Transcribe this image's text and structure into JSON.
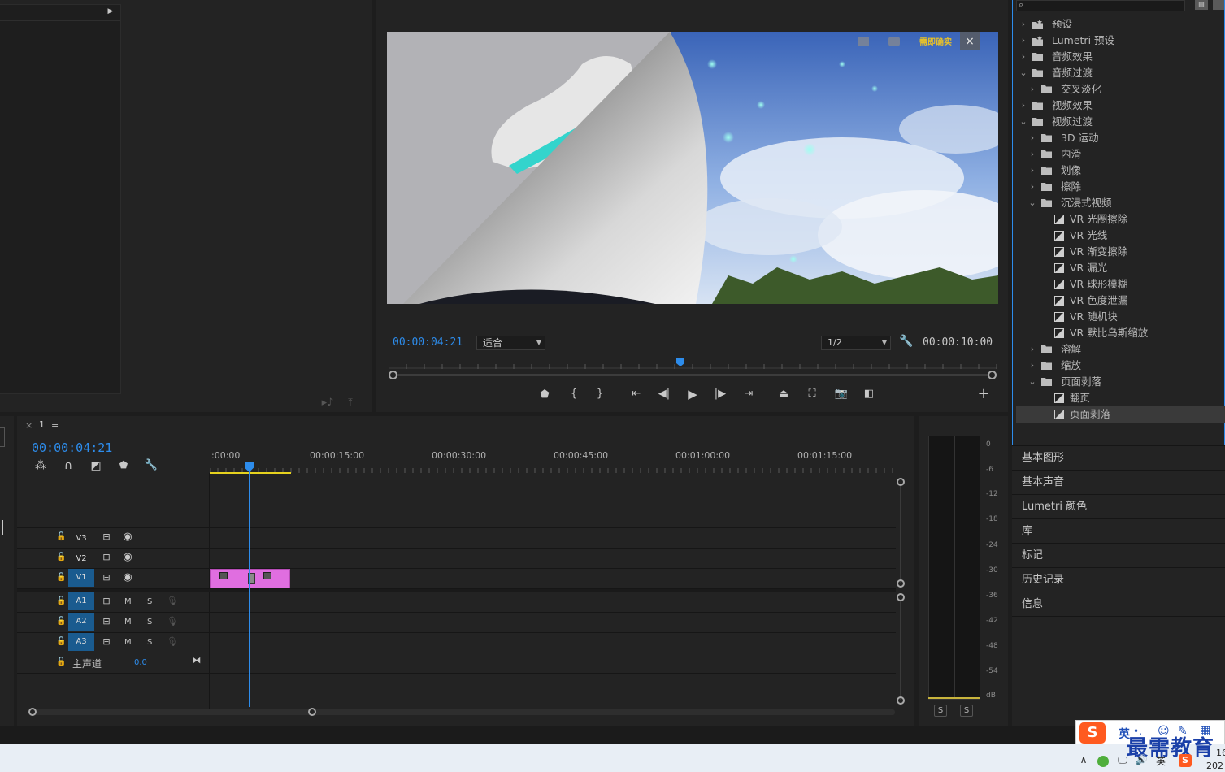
{
  "program_monitor": {
    "timecode_current": "00:00:04:21",
    "fit_label": "适合",
    "resolution_label": "1/2",
    "timecode_total": "00:00:10:00",
    "video_watermark": "需即确实"
  },
  "timeline": {
    "tab_close": "×",
    "tab_label": "1",
    "tab_menu": "≡",
    "timecode": "00:00:04:21",
    "ruler_labels": [
      ":00:00",
      "00:00:15:00",
      "00:00:30:00",
      "00:00:45:00",
      "00:01:00:00",
      "00:01:15:00"
    ],
    "video_tracks": [
      "V3",
      "V2",
      "V1"
    ],
    "audio_tracks": [
      "A1",
      "A2",
      "A3"
    ],
    "mute_label": "M",
    "solo_label": "S",
    "master_label": "主声道",
    "master_value": "0.0"
  },
  "meter": {
    "db_labels": [
      "0",
      "-6",
      "-12",
      "-18",
      "-24",
      "-30",
      "-36",
      "-42",
      "-48",
      "-54",
      "dB"
    ],
    "solo_left": "S",
    "solo_right": "S"
  },
  "effects": {
    "items": [
      {
        "label": "预设",
        "level": 0,
        "expanded": false,
        "icon": "preset-folder"
      },
      {
        "label": "Lumetri 预设",
        "level": 0,
        "expanded": false,
        "icon": "preset-folder"
      },
      {
        "label": "音频效果",
        "level": 0,
        "expanded": false,
        "icon": "folder"
      },
      {
        "label": "音频过渡",
        "level": 0,
        "expanded": true,
        "icon": "folder"
      },
      {
        "label": "交叉淡化",
        "level": 1,
        "expanded": false,
        "icon": "folder"
      },
      {
        "label": "视频效果",
        "level": 0,
        "expanded": false,
        "icon": "folder"
      },
      {
        "label": "视频过渡",
        "level": 0,
        "expanded": true,
        "icon": "folder"
      },
      {
        "label": "3D 运动",
        "level": 1,
        "expanded": false,
        "icon": "folder"
      },
      {
        "label": "内滑",
        "level": 1,
        "expanded": false,
        "icon": "folder"
      },
      {
        "label": "划像",
        "level": 1,
        "expanded": false,
        "icon": "folder"
      },
      {
        "label": "擦除",
        "level": 1,
        "expanded": false,
        "icon": "folder"
      },
      {
        "label": "沉浸式视频",
        "level": 1,
        "expanded": true,
        "icon": "folder"
      },
      {
        "label": "VR 光圈擦除",
        "level": 2,
        "icon": "transition"
      },
      {
        "label": "VR 光线",
        "level": 2,
        "icon": "transition"
      },
      {
        "label": "VR 渐变擦除",
        "level": 2,
        "icon": "transition"
      },
      {
        "label": "VR 漏光",
        "level": 2,
        "icon": "transition"
      },
      {
        "label": "VR 球形模糊",
        "level": 2,
        "icon": "transition"
      },
      {
        "label": "VR 色度泄漏",
        "level": 2,
        "icon": "transition"
      },
      {
        "label": "VR 随机块",
        "level": 2,
        "icon": "transition"
      },
      {
        "label": "VR 默比乌斯缩放",
        "level": 2,
        "icon": "transition"
      },
      {
        "label": "溶解",
        "level": 1,
        "expanded": false,
        "icon": "folder"
      },
      {
        "label": "缩放",
        "level": 1,
        "expanded": false,
        "icon": "folder"
      },
      {
        "label": "页面剥落",
        "level": 1,
        "expanded": true,
        "icon": "folder"
      },
      {
        "label": "翻页",
        "level": 2,
        "icon": "transition"
      },
      {
        "label": "页面剥落",
        "level": 2,
        "icon": "transition",
        "selected": true
      }
    ]
  },
  "side_panels": [
    "基本图形",
    "基本声音",
    "Lumetri 颜色",
    "库",
    "标记",
    "历史记录",
    "信息"
  ],
  "taskbar": {
    "ime_lang": "英",
    "clock_line1": "16",
    "clock_line2": "202",
    "watermark": "最需教育"
  },
  "colors": {
    "accent_blue": "#2d8ceb",
    "clip_pink": "#e06ee0",
    "track_toggle_blue": "#1a5b8f",
    "work_area_yellow": "#e6d21e"
  }
}
